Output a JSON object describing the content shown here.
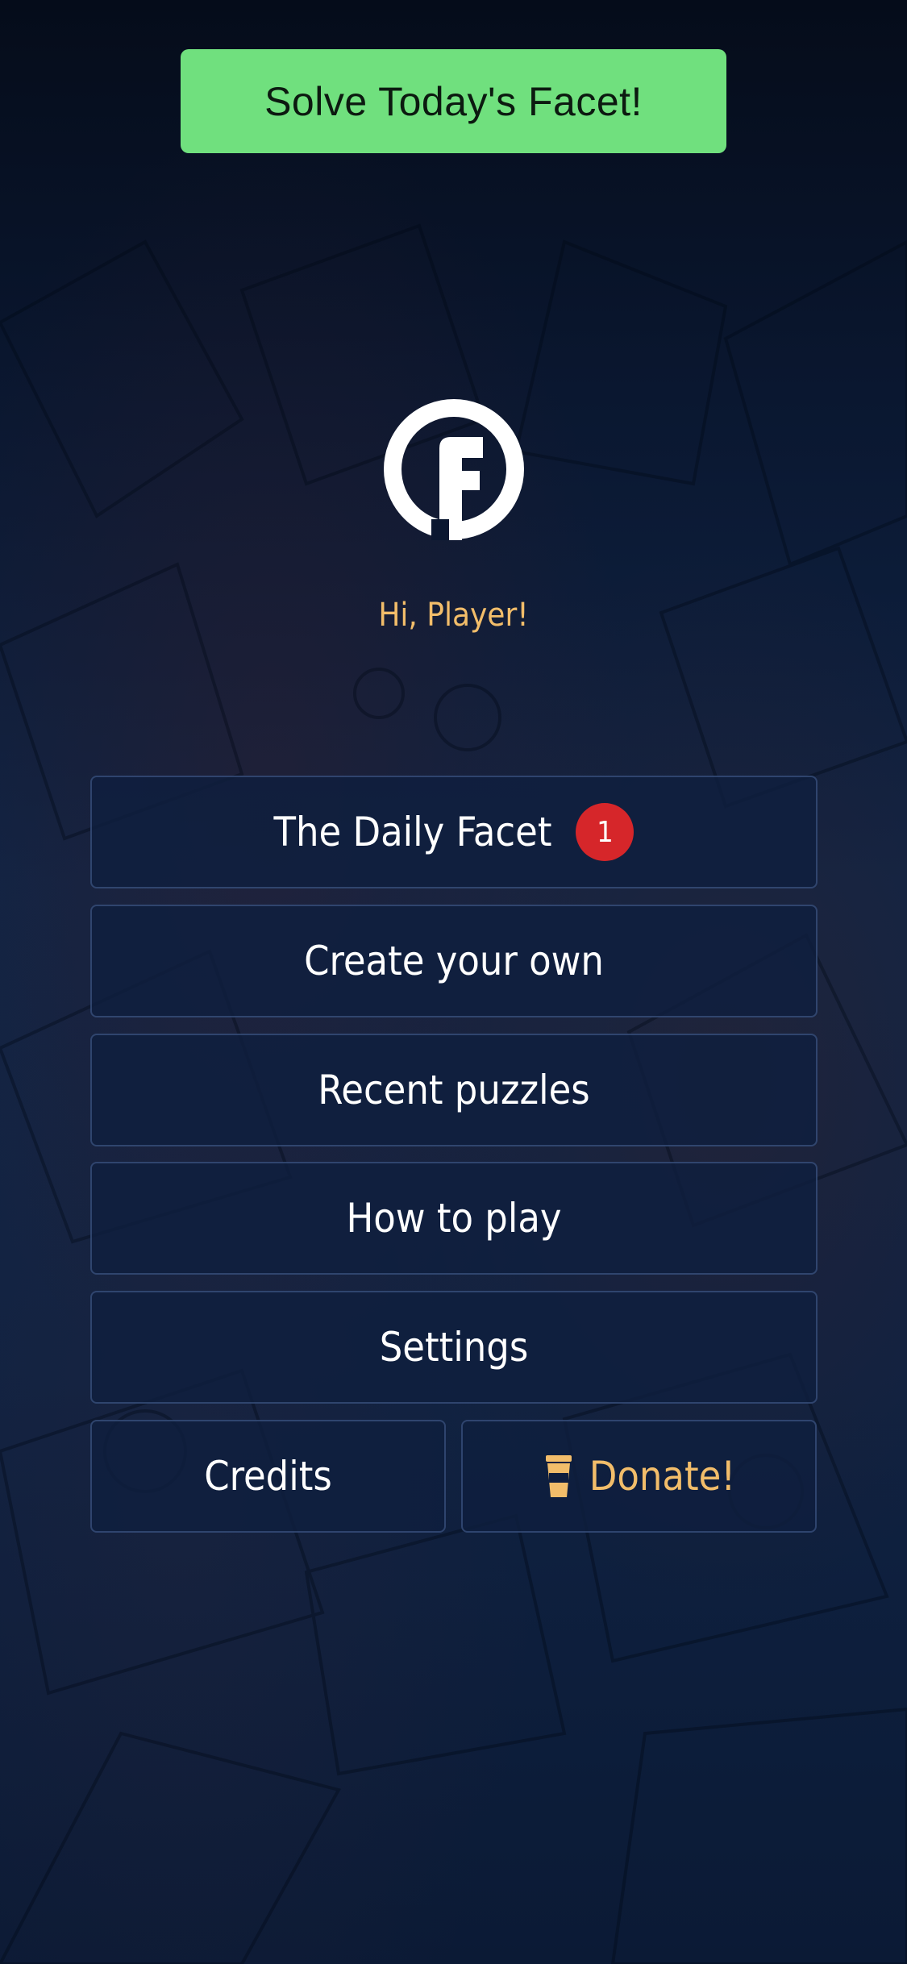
{
  "top_cta": {
    "label": "Solve Today's Facet!"
  },
  "logo": {
    "letter": "F"
  },
  "greeting": "Hi, Player!",
  "menu": {
    "daily": {
      "label": "The Daily Facet",
      "badge": "1"
    },
    "create": {
      "label": "Create your own"
    },
    "recent": {
      "label": "Recent puzzles"
    },
    "howto": {
      "label": "How to play"
    },
    "settings": {
      "label": "Settings"
    },
    "credits": {
      "label": "Credits"
    },
    "donate": {
      "label": "Donate!",
      "icon": "coffee-cup-icon"
    }
  },
  "colors": {
    "cta_green": "#70e07e",
    "accent_orange": "#f2bd6a",
    "badge_red": "#d6262a"
  }
}
